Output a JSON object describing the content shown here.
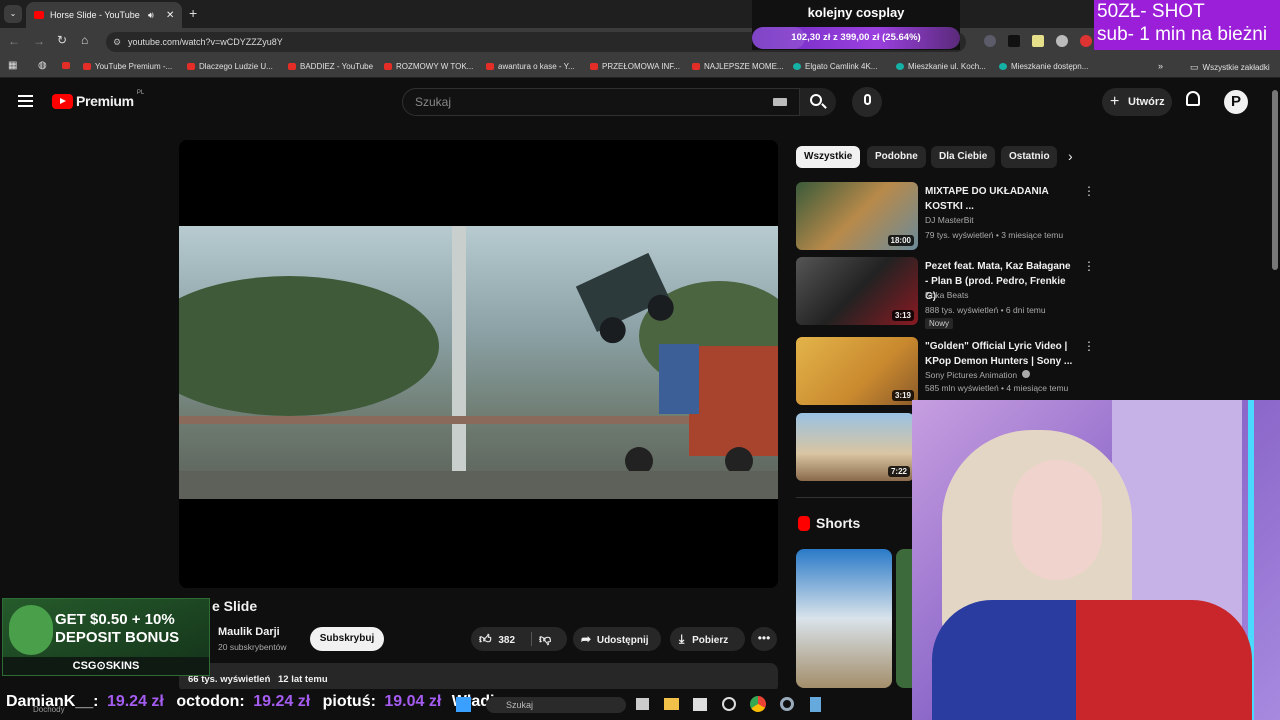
{
  "browser": {
    "tab_title": "Horse Slide - YouTube",
    "url": "youtube.com/watch?v=wCDYZZZyu8Y",
    "bookmarks": [
      "YouTube Premium -...",
      "Dlaczego Ludzie U...",
      "BADDIEZ - YouTube",
      "ROZMOWY W TOK...",
      "awantura o kase - Y...",
      "PRZEŁOMOWA INF...",
      "NAJLEPSZE MOME...",
      "Elgato Camlink 4K...",
      "Mieszkanie ul. Koch...",
      "Mieszkanie dostępn..."
    ],
    "all_bookmarks": "Wszystkie zakładki"
  },
  "stream": {
    "title": "kolejny cosplay",
    "goal": "102,30 zł z 399,00 zł (25.64%)",
    "goal_progress": 0.2564,
    "shot_line1": "50ZŁ- SHOT",
    "shot_line2": "sub- 1 min na bieżni",
    "ad_line1": "GET $0.50 + 10%",
    "ad_line2": "DEPOSIT BONUS",
    "ad_brand": "CSG⊙SKINS",
    "ticker": [
      {
        "name": "DamianK__:",
        "amount": "19.24 zł"
      },
      {
        "name": "octodon:",
        "amount": "19.24 zł"
      },
      {
        "name": "piotuś:",
        "amount": "19.04 zł"
      },
      {
        "name": "Władi",
        "amount": ""
      }
    ],
    "tray_label": "Dochody",
    "taskbar_search": "Szukaj"
  },
  "youtube": {
    "logo": "Premium",
    "logo_sup": "PL",
    "search_placeholder": "Szukaj",
    "create": "Utwórz",
    "avatar_letter": "P",
    "video_title": "e Slide",
    "channel": "Maulik Darji",
    "subscribers": "20 subskrybentów",
    "subscribe": "Subskrybuj",
    "likes": "382",
    "share": "Udostępnij",
    "download": "Pobierz",
    "views": "66 tys. wyświetleń",
    "age": "12 lat temu",
    "chips": [
      "Wszystkie",
      "Podobne",
      "Dla Ciebie",
      "Ostatnio"
    ],
    "shorts": "Shorts",
    "recs": [
      {
        "title": "MIXTAPE DO UKŁADANIA KOSTKI ...",
        "channel": "DJ MasterBit",
        "meta": "79 tys. wyświetleń • 3 miesiące temu",
        "duration": "18:00",
        "badge": ""
      },
      {
        "title": "Pezet feat. Mata, Kaz Bałagane - Plan B (prod. Pedro, Frenkie G)",
        "channel": "Koka Beats",
        "meta": "888 tys. wyświetleń • 6 dni temu",
        "duration": "3:13",
        "badge": "Nowy"
      },
      {
        "title": "\"Golden\" Official Lyric Video | KPop Demon Hunters | Sony ...",
        "channel": "Sony Pictures Animation",
        "meta": "585 mln wyświetleń • 4 miesiące temu",
        "duration": "3:19",
        "badge": ""
      },
      {
        "title": "",
        "channel": "",
        "meta": "",
        "duration": "7:22",
        "badge": ""
      }
    ]
  }
}
